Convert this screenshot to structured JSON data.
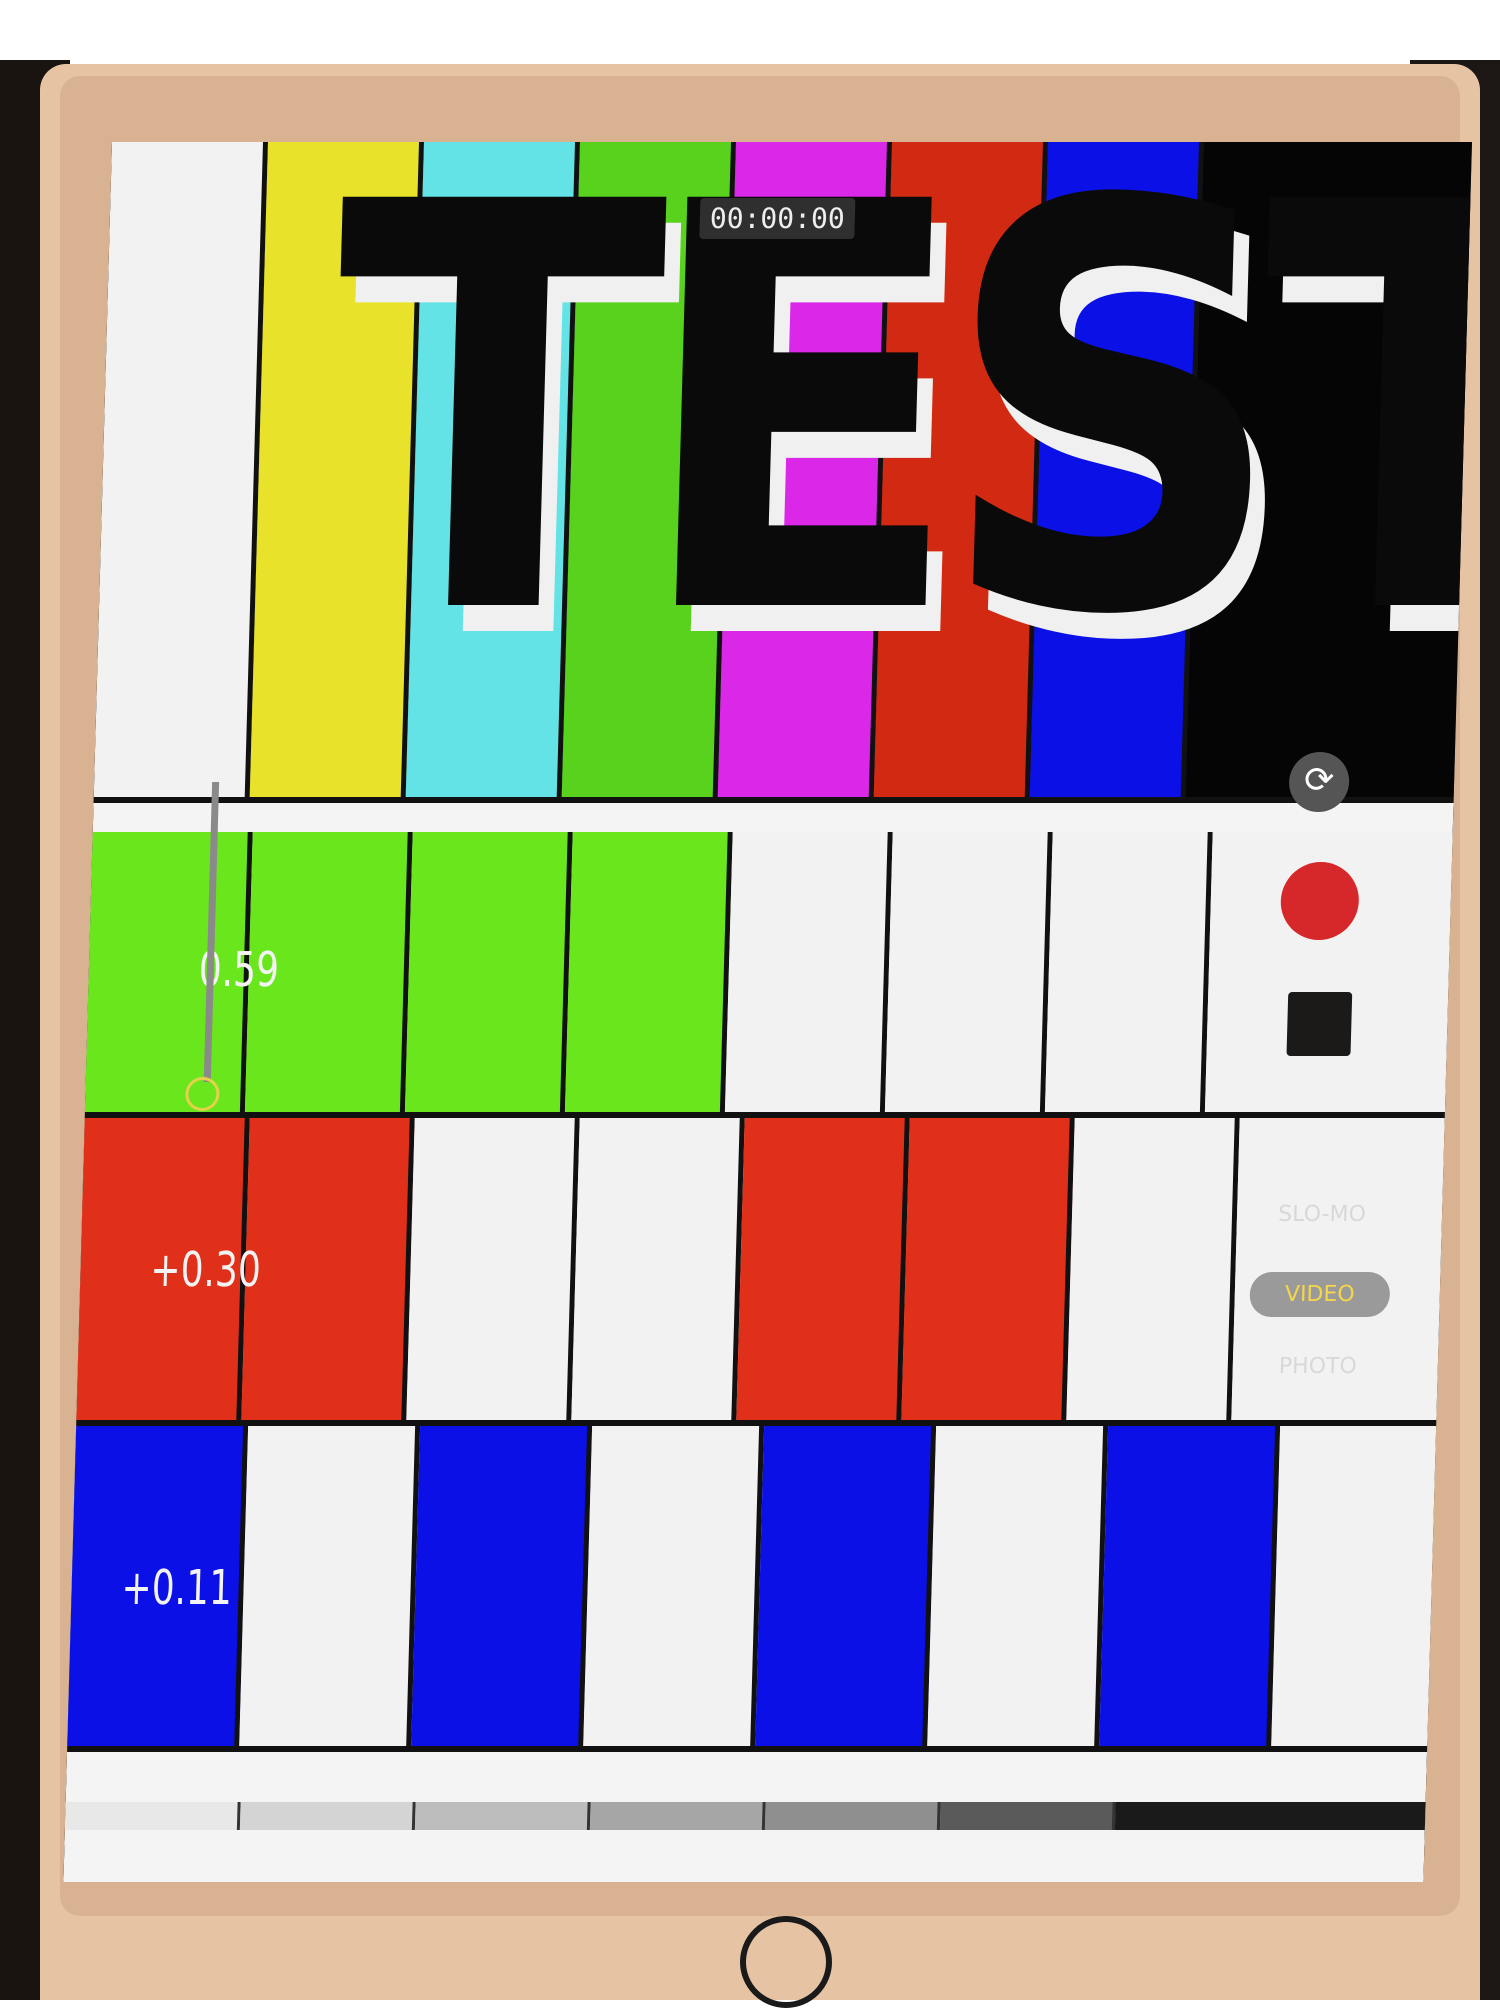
{
  "camera": {
    "timer": "00:00:00",
    "modes": [
      {
        "label": "SLO-MO"
      },
      {
        "label": "VIDEO"
      },
      {
        "label": "PHOTO"
      }
    ],
    "selected_mode": "VIDEO",
    "exposure_values": [
      "0.59",
      "+0.30",
      "+0.11"
    ]
  },
  "chart_text": {
    "headline": "TEST"
  },
  "colors": {
    "white": "#f2f2f2",
    "yellow": "#e8e32a",
    "cyan": "#63e3e6",
    "green": "#58d21d",
    "magenta": "#db28e8",
    "red": "#d22a12",
    "blue": "#0a10e6",
    "black": "#050505",
    "lime": "#6ae61c",
    "record_red": "#d6282a"
  },
  "icons": {
    "flip": "flip-camera-icon",
    "record": "record-icon",
    "stop": "stop-icon",
    "home": "home-button-icon"
  }
}
